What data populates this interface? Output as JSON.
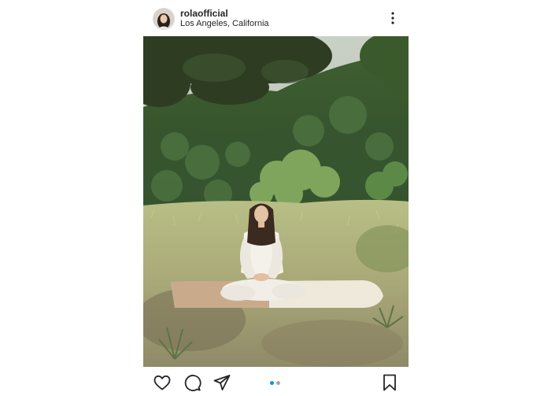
{
  "post": {
    "username": "rolaofficial",
    "location": "Los Angeles, California"
  },
  "icons": {
    "more": "more-vertical-icon",
    "like": "heart-icon",
    "comment": "comment-bubble-icon",
    "share": "paper-plane-icon",
    "save": "bookmark-icon"
  },
  "carousel": {
    "total_slides": 2,
    "active_slide": 1,
    "active_color": "#0095f6",
    "inactive_color": "#a8a8a8"
  }
}
